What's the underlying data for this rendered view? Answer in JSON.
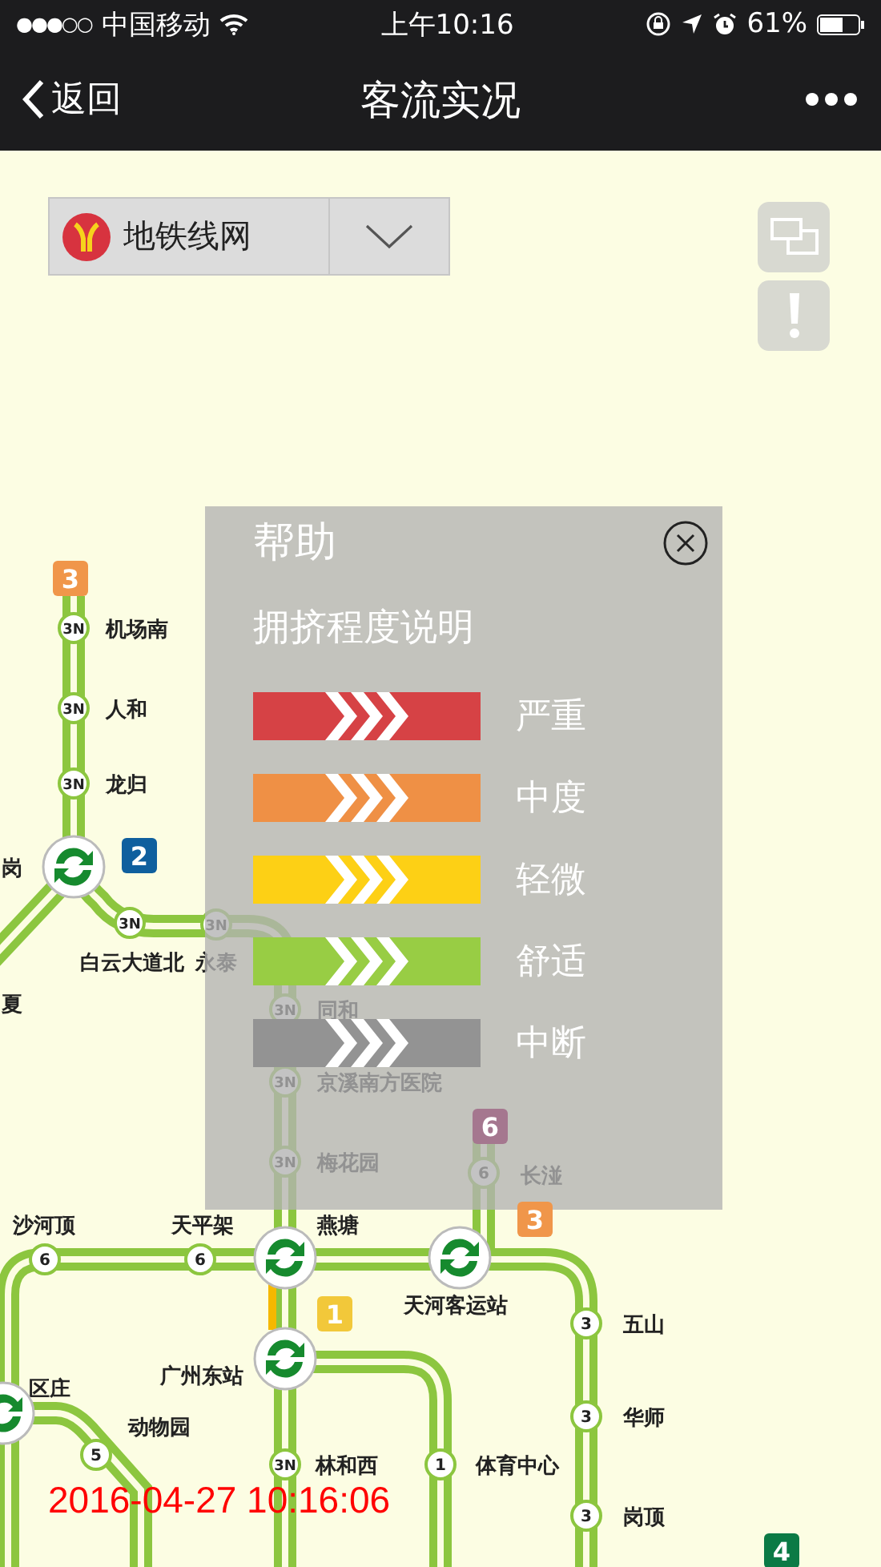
{
  "status_bar": {
    "signal": "●●●○○",
    "carrier": "中国移动",
    "time": "上午10:16",
    "battery": "61%"
  },
  "nav": {
    "back": "返回",
    "title": "客流实况"
  },
  "line_selector": {
    "label": "地铁线网"
  },
  "map": {
    "line_badges": [
      {
        "label": "3",
        "color": "#f0964a"
      },
      {
        "label": "2",
        "color": "#0f5f9e"
      },
      {
        "label": "6",
        "color": "#a5778f"
      },
      {
        "label": "3",
        "color": "#f0964a"
      },
      {
        "label": "1",
        "color": "#f2c83a"
      },
      {
        "label": "4",
        "color": "#0b7a45"
      }
    ],
    "stations": [
      {
        "name": "机场南",
        "code": "3N"
      },
      {
        "name": "人和",
        "code": "3N"
      },
      {
        "name": "龙归",
        "code": "3N"
      },
      {
        "name": "岗"
      },
      {
        "name": "白云大道北",
        "code": "3N"
      },
      {
        "name": "永泰",
        "code": "3N"
      },
      {
        "name": "夏"
      },
      {
        "name": "同和",
        "code": "3N"
      },
      {
        "name": "京溪南方医院",
        "code": "3N"
      },
      {
        "name": "梅花园",
        "code": "3N"
      },
      {
        "name": "长湴",
        "code": "6"
      },
      {
        "name": "沙河顶",
        "code": "6"
      },
      {
        "name": "天平架",
        "code": "6"
      },
      {
        "name": "燕塘"
      },
      {
        "name": "天河客运站"
      },
      {
        "name": "五山",
        "code": "3"
      },
      {
        "name": "华师",
        "code": "3"
      },
      {
        "name": "广州东站"
      },
      {
        "name": "区庄"
      },
      {
        "name": "动物园",
        "code": "5"
      },
      {
        "name": "林和西",
        "code": "3N"
      },
      {
        "name": "体育中心",
        "code": "1"
      },
      {
        "name": "岗顶",
        "code": "3"
      }
    ],
    "timestamp": "2016-04-27 10:16:06"
  },
  "help": {
    "title": "帮助",
    "subtitle": "拥挤程度说明",
    "legend": [
      {
        "label": "严重",
        "color": "#d64245"
      },
      {
        "label": "中度",
        "color": "#ef9045"
      },
      {
        "label": "轻微",
        "color": "#fdd015"
      },
      {
        "label": "舒适",
        "color": "#98cd44"
      },
      {
        "label": "中断",
        "color": "#939393"
      }
    ]
  }
}
